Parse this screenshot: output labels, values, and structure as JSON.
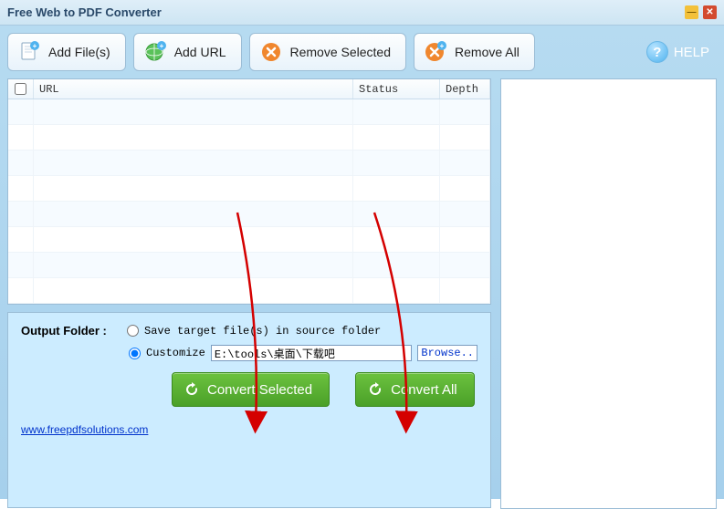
{
  "titlebar": {
    "title": "Free Web to PDF Converter"
  },
  "toolbar": {
    "add_files": "Add File(s)",
    "add_url": "Add URL",
    "remove_selected": "Remove Selected",
    "remove_all": "Remove All",
    "help": "HELP"
  },
  "table": {
    "headers": {
      "url": "URL",
      "status": "Status",
      "depth": "Depth"
    }
  },
  "output": {
    "label": "Output Folder :",
    "save_in_source": "Save target file(s) in source folder",
    "customize": "Customize",
    "path": "E:\\tools\\桌面\\下载吧",
    "browse": "Browse..",
    "convert_selected": "Convert Selected",
    "convert_all": "Convert All",
    "link": "www.freepdfsolutions.com"
  }
}
